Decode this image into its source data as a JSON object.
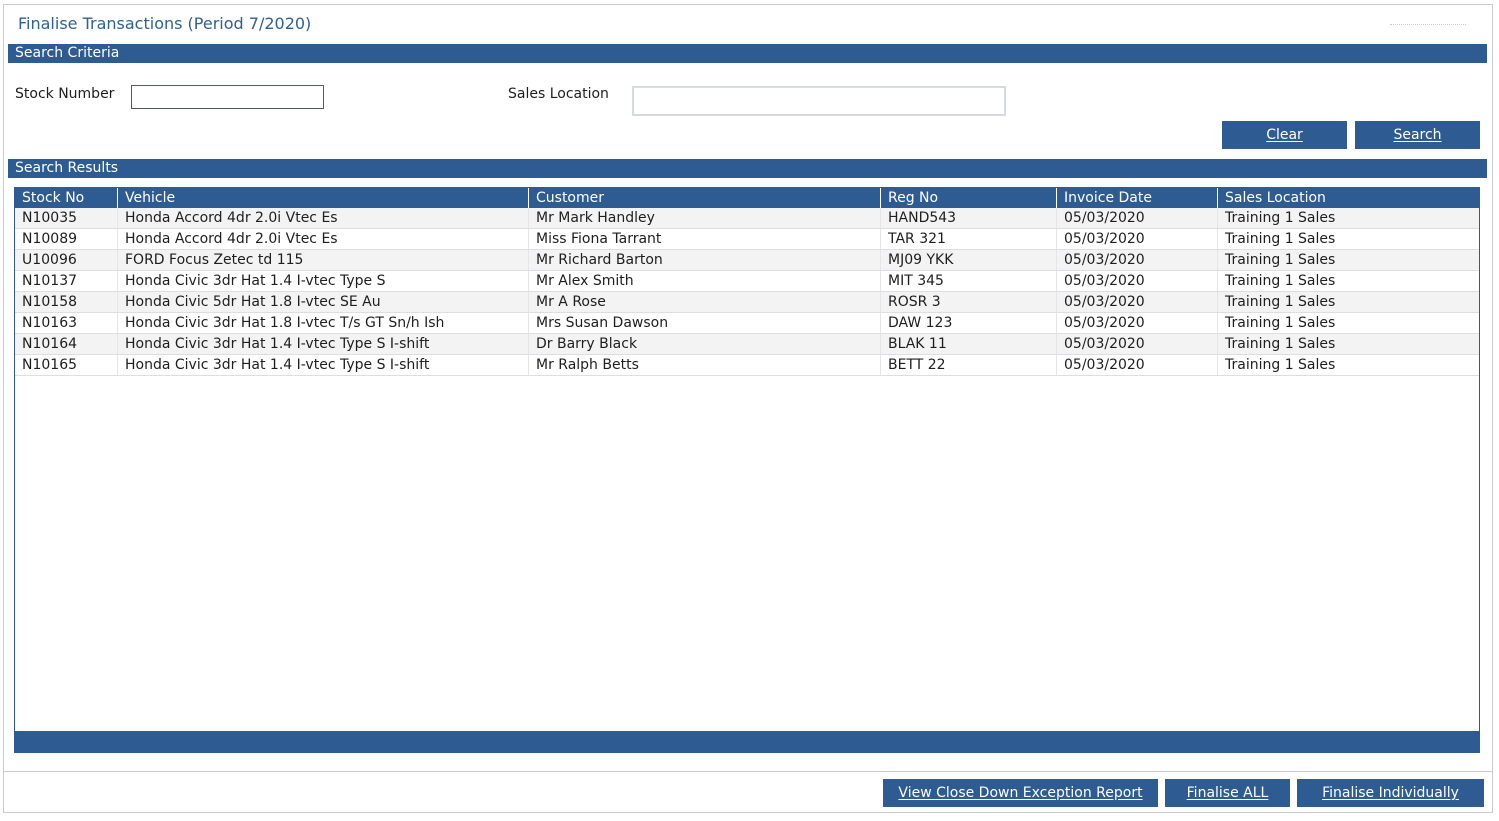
{
  "window": {
    "title": "Finalise Transactions (Period 7/2020)"
  },
  "search_criteria": {
    "header": "Search Criteria",
    "stock_number_label": "Stock Number",
    "stock_number_value": "",
    "sales_location_label": "Sales Location",
    "sales_location_value": "",
    "clear_label": "Clear",
    "search_label": "Search"
  },
  "search_results": {
    "header": "Search Results",
    "columns": [
      "Stock No",
      "Vehicle",
      "Customer",
      "Reg No",
      "Invoice Date",
      "Sales Location"
    ],
    "rows": [
      [
        "N10035",
        "Honda Accord 4dr 2.0i Vtec Es",
        "Mr Mark Handley",
        "HAND543",
        "05/03/2020",
        "Training 1 Sales"
      ],
      [
        "N10089",
        "Honda Accord 4dr 2.0i Vtec Es",
        "Miss Fiona Tarrant",
        "TAR 321",
        "05/03/2020",
        "Training 1 Sales"
      ],
      [
        "U10096",
        "FORD Focus Zetec td 115",
        "Mr Richard Barton",
        "MJ09 YKK",
        "05/03/2020",
        "Training 1 Sales"
      ],
      [
        "N10137",
        "Honda Civic 3dr Hat 1.4 I-vtec Type S",
        "Mr Alex Smith",
        "MIT 345",
        "05/03/2020",
        "Training 1 Sales"
      ],
      [
        "N10158",
        "Honda Civic 5dr Hat 1.8 I-vtec SE Au",
        "Mr A Rose",
        "ROSR 3",
        "05/03/2020",
        "Training 1 Sales"
      ],
      [
        "N10163",
        "Honda Civic 3dr Hat 1.8 I-vtec T/s GT Sn/h Ish",
        "Mrs Susan Dawson",
        "DAW 123",
        "05/03/2020",
        "Training 1 Sales"
      ],
      [
        "N10164",
        "Honda Civic 3dr Hat 1.4 I-vtec Type S I-shift",
        "Dr Barry Black",
        "BLAK 11",
        "05/03/2020",
        "Training 1 Sales"
      ],
      [
        "N10165",
        "Honda Civic 3dr Hat 1.4 I-vtec Type S I-shift",
        "Mr Ralph Betts",
        "BETT 22",
        "05/03/2020",
        "Training 1 Sales"
      ]
    ]
  },
  "footer": {
    "exception_report_label": "View Close Down Exception Report",
    "finalise_all_label": "Finalise ALL",
    "finalise_individually_label": "Finalise Individually"
  },
  "colors": {
    "accent": "#2e5c92",
    "title": "#2f6191"
  }
}
